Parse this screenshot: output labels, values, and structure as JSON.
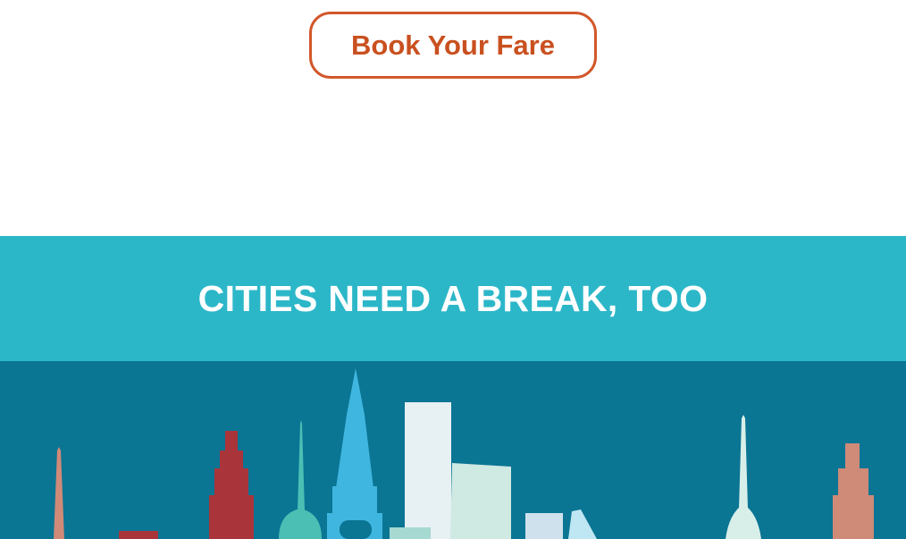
{
  "cta": {
    "label": "Book Your Fare"
  },
  "banner": {
    "title": "CITIES NEED A BREAK, TOO"
  },
  "skyline": {
    "icon": "city-skyline-illustration"
  },
  "colors": {
    "accent": "#d2572a",
    "banner_bg": "#2cb7c9",
    "skyline_bg": "#0b7594"
  }
}
